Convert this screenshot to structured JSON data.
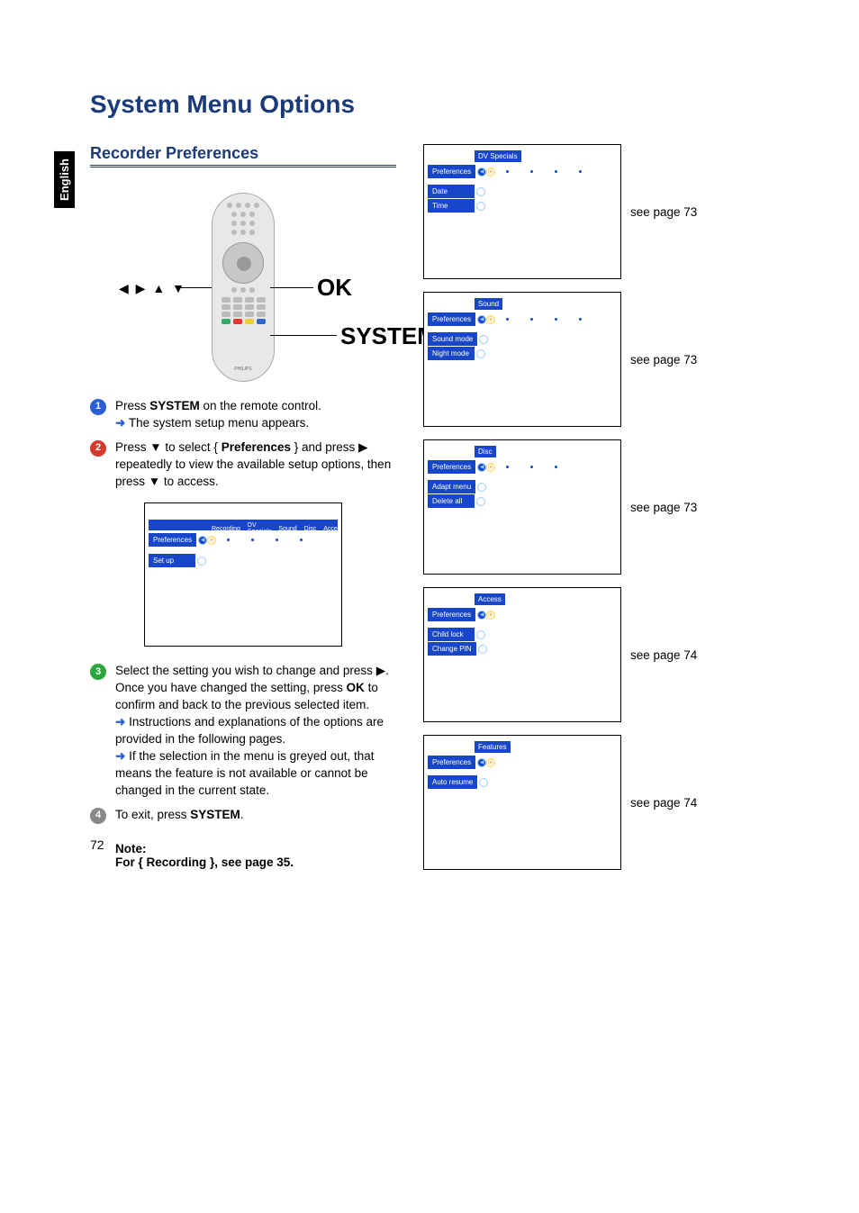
{
  "language_tab": "English",
  "main_title": "System Menu Options",
  "section_heading": "Recorder Preferences",
  "remote": {
    "nav_glyphs": "◀ ▶ ▲ ▼",
    "ok_label": "OK",
    "system_label": "SYSTEM",
    "brand": "PHILIPS"
  },
  "steps": {
    "s1_a": "Press ",
    "s1_b": "SYSTEM",
    "s1_c": " on the remote control.",
    "s1_r": " The system setup menu appears.",
    "s2_a": "Press ",
    "s2_b": " to select { ",
    "s2_c": "Preferences",
    "s2_d": " } and press ",
    "s2_e": " repeatedly to view the available setup options, then press ",
    "s2_f": " to access.",
    "s3_a": "Select the setting you wish to change and press ",
    "s3_b": ". Once you have changed the setting, press ",
    "s3_c": "OK",
    "s3_d": " to confirm and back to the previous selected item.",
    "s3_r1": " Instructions and explanations of the options are provided in the following pages.",
    "s3_r2": " If the selection in the menu is greyed out, that means the feature is not available or cannot be changed in the current state.",
    "s4_a": "To exit, press ",
    "s4_b": "SYSTEM",
    "s4_c": "."
  },
  "left_menu": {
    "preferences": "Preferences",
    "headers": [
      "Recording",
      "DV Specials",
      "Sound",
      "Disc",
      "Access"
    ],
    "item1": "Set up"
  },
  "right_menus": [
    {
      "selected_header": "DV Specials",
      "preferences": "Preferences",
      "items": [
        "Date",
        "Time"
      ],
      "see": "see page 73"
    },
    {
      "selected_header": "Sound",
      "preferences": "Preferences",
      "items": [
        "Sound mode",
        "Night mode"
      ],
      "see": "see page 73"
    },
    {
      "selected_header": "Disc",
      "preferences": "Preferences",
      "items": [
        "Adapt menu",
        "Delete all"
      ],
      "see": "see page 73"
    },
    {
      "selected_header": "Access",
      "preferences": "Preferences",
      "items": [
        "Child lock",
        "Change PIN"
      ],
      "see": "see page 74"
    },
    {
      "selected_header": "Features",
      "preferences": "Preferences",
      "items": [
        "Auto resume"
      ],
      "see": "see page 74"
    }
  ],
  "note": {
    "title": "Note:",
    "body": "For { Recording }, see page 35."
  },
  "page_number": "72",
  "glyphs": {
    "down": "▼",
    "right": "▶",
    "result": "➜"
  }
}
